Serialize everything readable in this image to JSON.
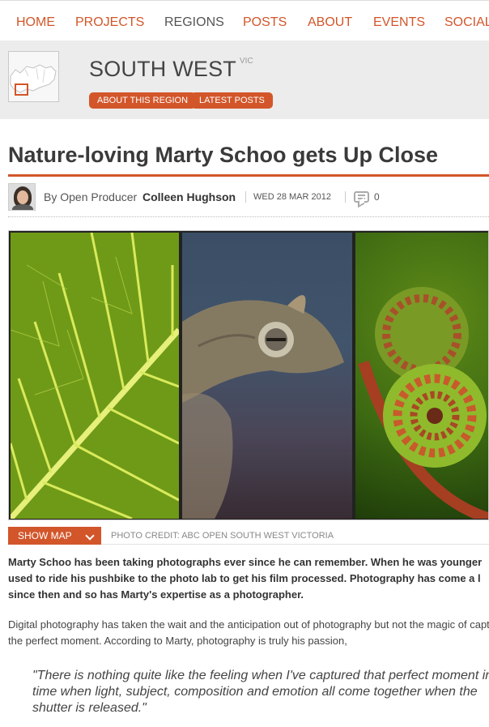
{
  "nav": {
    "items": [
      "HOME",
      "PROJECTS",
      "REGIONS",
      "POSTS",
      "ABOUT",
      "EVENTS",
      "SOCIAL"
    ],
    "active": "REGIONS"
  },
  "region": {
    "name": "SOUTH WEST",
    "state": "VIC",
    "about_button": "ABOUT THIS REGION",
    "latest_button": "LATEST POSTS"
  },
  "article": {
    "title": "Nature-loving Marty Schoo gets Up Close",
    "byline_prefix": "By Open Producer",
    "author": "Colleen Hughson",
    "date": "WED 28 MAR 2012",
    "comment_count": "0"
  },
  "media": {
    "show_map_label": "SHOW MAP",
    "photo_credit": "PHOTO CREDIT: ABC OPEN SOUTH WEST VICTORIA"
  },
  "body": {
    "lead_lines": [
      "Marty Schoo has been taking photographs ever since he can remember. When he was younger",
      "used to ride his pushbike to the photo lab to get his film processed. Photography has come a l",
      "since then and so has Marty's expertise as a photographer."
    ],
    "para_lines": [
      "Digital photography has taken the wait and the anticipation out of photography but not the magic of capt",
      "the perfect moment. According to Marty, photography is truly his passion,"
    ],
    "quote_lines": [
      "\"There is nothing quite like the feeling when I've captured that perfect moment in",
      "time when light, subject, composition and emotion all come together when the",
      "shutter is released.\""
    ]
  },
  "colors": {
    "accent": "#d2562a",
    "region_band": "#ececec"
  }
}
